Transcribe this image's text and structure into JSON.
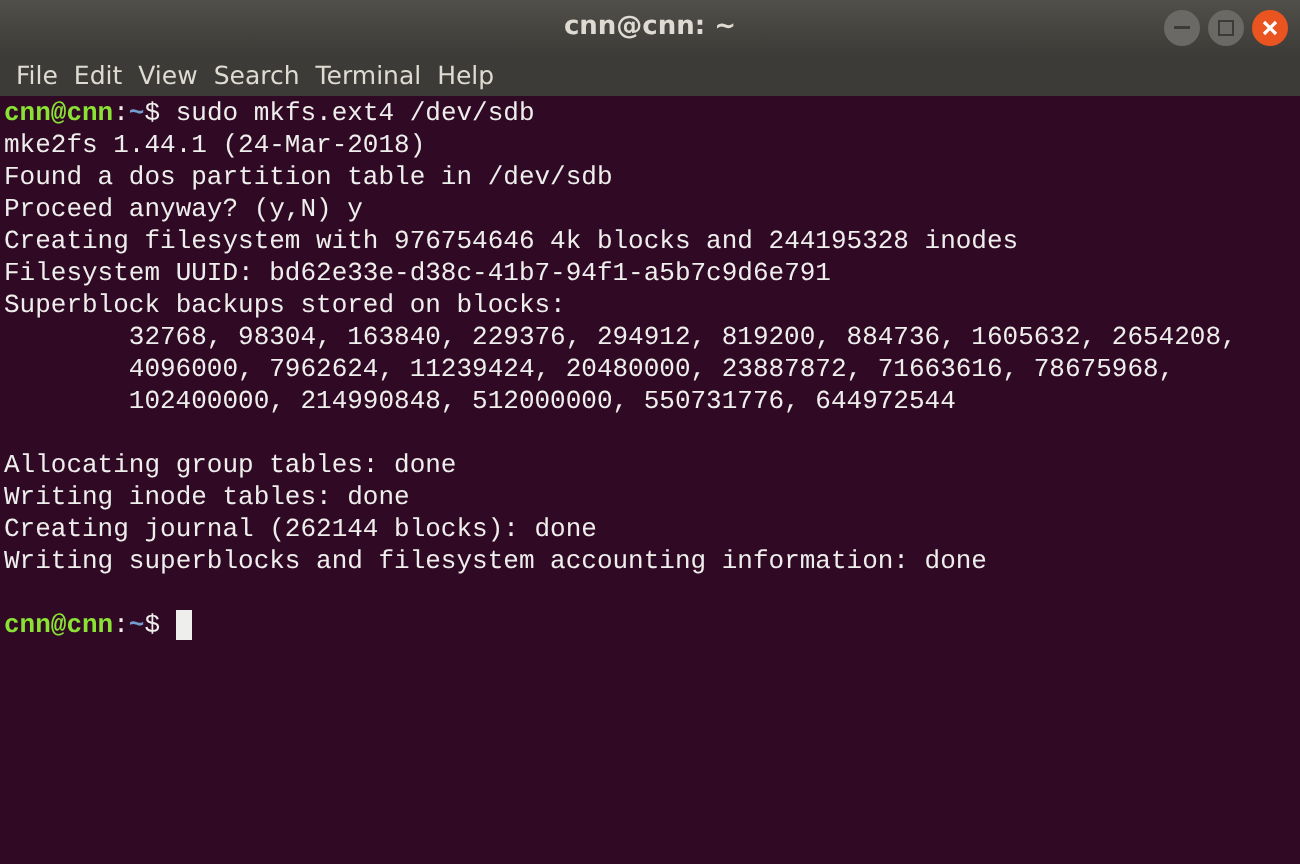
{
  "window": {
    "title": "cnn@cnn: ~"
  },
  "menu": [
    "File",
    "Edit",
    "View",
    "Search",
    "Terminal",
    "Help"
  ],
  "lines": [
    {
      "kind": "prompt",
      "user": "cnn@cnn",
      "separator": ":",
      "path": "~",
      "symbol": "$",
      "command": "sudo mkfs.ext4 /dev/sdb",
      "cursor": false
    },
    {
      "kind": "output",
      "text": "mke2fs 1.44.1 (24-Mar-2018)"
    },
    {
      "kind": "output",
      "text": "Found a dos partition table in /dev/sdb"
    },
    {
      "kind": "output",
      "text": "Proceed anyway? (y,N) y"
    },
    {
      "kind": "output",
      "text": "Creating filesystem with 976754646 4k blocks and 244195328 inodes"
    },
    {
      "kind": "output",
      "text": "Filesystem UUID: bd62e33e-d38c-41b7-94f1-a5b7c9d6e791"
    },
    {
      "kind": "output",
      "text": "Superblock backups stored on blocks:"
    },
    {
      "kind": "indented",
      "text": "32768, 98304, 163840, 229376, 294912, 819200, 884736, 1605632, 2654208,"
    },
    {
      "kind": "indented",
      "text": "4096000, 7962624, 11239424, 20480000, 23887872, 71663616, 78675968,"
    },
    {
      "kind": "indented",
      "text": "102400000, 214990848, 512000000, 550731776, 644972544"
    },
    {
      "kind": "blank"
    },
    {
      "kind": "output",
      "text": "Allocating group tables: done"
    },
    {
      "kind": "output",
      "text": "Writing inode tables: done"
    },
    {
      "kind": "output",
      "text": "Creating journal (262144 blocks): done"
    },
    {
      "kind": "output",
      "text": "Writing superblocks and filesystem accounting information: done"
    },
    {
      "kind": "blank"
    },
    {
      "kind": "prompt",
      "user": "cnn@cnn",
      "separator": ":",
      "path": "~",
      "symbol": "$",
      "cursor": true
    }
  ]
}
